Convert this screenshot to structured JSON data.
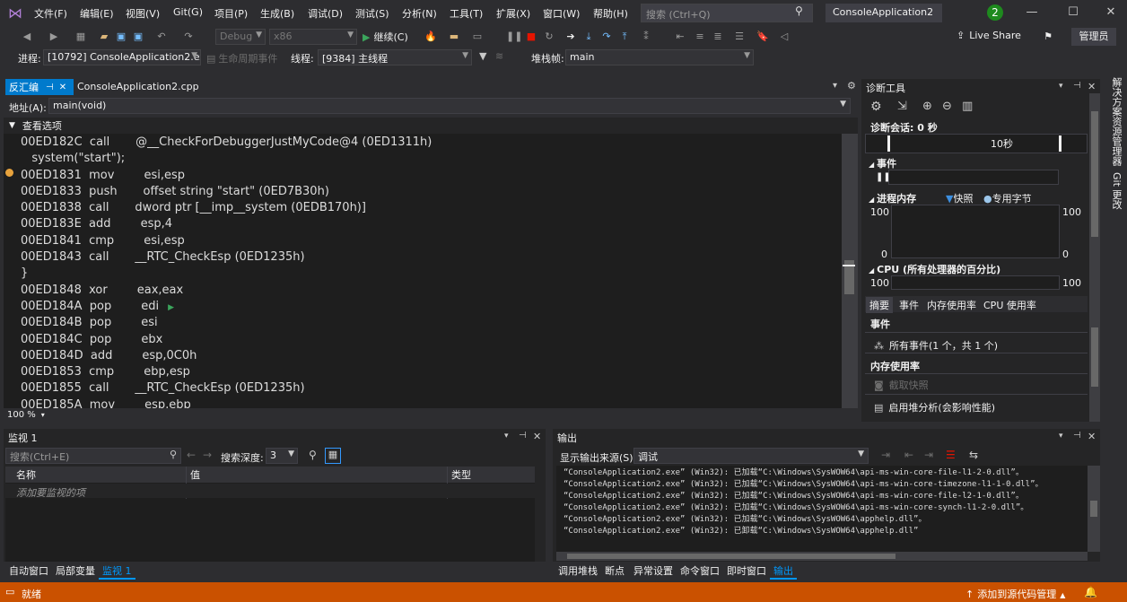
{
  "menubar": {
    "items": [
      "文件(F)",
      "编辑(E)",
      "视图(V)",
      "Git(G)",
      "项目(P)",
      "生成(B)",
      "调试(D)",
      "测试(S)",
      "分析(N)",
      "工具(T)",
      "扩展(X)",
      "窗口(W)",
      "帮助(H)"
    ],
    "search_placeholder": "搜索 (Ctrl+Q)",
    "project_name": "ConsoleApplication2",
    "notification_count": "2"
  },
  "toolbar": {
    "config": "Debug",
    "platform": "x86",
    "continue_label": "继续(C)",
    "live_share": "Live Share",
    "admin": "管理员"
  },
  "debugbar": {
    "process_label": "进程:",
    "process_value": "[10792] ConsoleApplication2.ex",
    "lifecycle": "生命周期事件",
    "thread_label": "线程:",
    "thread_value": "[9384] 主线程",
    "stackframe_label": "堆栈帧:",
    "stackframe_value": "main"
  },
  "editor": {
    "tab_disasm": "反汇编",
    "tab_cpp": "ConsoleApplication2.cpp",
    "address_label": "地址(A):",
    "address_value": "main(void)",
    "view_options": "查看选项",
    "zoom": "100 %",
    "lines": [
      "00ED182C  call       @__CheckForDebuggerJustMyCode@4 (0ED1311h)",
      "   system(\"start\");",
      "00ED1831  mov        esi,esp",
      "00ED1833  push       offset string \"start\" (0ED7B30h)",
      "00ED1838  call       dword ptr [__imp__system (0EDB170h)]",
      "00ED183E  add        esp,4",
      "00ED1841  cmp        esi,esp",
      "00ED1843  call       __RTC_CheckEsp (0ED1235h)",
      "}",
      "00ED1848  xor        eax,eax",
      "00ED184A  pop        edi",
      "00ED184B  pop        esi",
      "00ED184C  pop        ebx",
      "00ED184D  add        esp,0C0h",
      "00ED1853  cmp        ebp,esp",
      "00ED1855  call       __RTC_CheckEsp (0ED1235h)",
      "00ED185A  mov        esp,ebp"
    ]
  },
  "diagnostics": {
    "title": "诊断工具",
    "session": "诊断会话: 0 秒",
    "timeline_label": "10秒",
    "events_section": "事件",
    "memory_section": "进程内存",
    "snapshot_legend": "快照",
    "private_bytes_legend": "专用字节",
    "mem_top_left": "100",
    "mem_top_right": "100",
    "mem_bottom_left": "0",
    "mem_bottom_right": "0",
    "cpu_section": "CPU (所有处理器的百分比)",
    "cpu_left": "100",
    "cpu_right": "100",
    "tabs": [
      "摘要",
      "事件",
      "内存使用率",
      "CPU 使用率"
    ],
    "events_heading": "事件",
    "all_events": "所有事件(1 个，共 1 个)",
    "memory_heading": "内存使用率",
    "take_snapshot": "截取快照",
    "heap_profiling": "启用堆分析(会影响性能)"
  },
  "sidebar": {
    "solution_explorer": "解决方案资源管理器",
    "git_changes": "Git 更改"
  },
  "watch": {
    "title": "监视 1",
    "search_placeholder": "搜索(Ctrl+E)",
    "depth_label": "搜索深度:",
    "depth_value": "3",
    "col_name": "名称",
    "col_value": "值",
    "col_type": "类型",
    "add_item": "添加要监视的项"
  },
  "output": {
    "title": "输出",
    "source_label": "显示输出来源(S):",
    "source_value": "调试",
    "lines": [
      "“ConsoleApplication2.exe” (Win32): 已加载“C:\\Windows\\SysWOW64\\api-ms-win-core-file-l1-2-0.dll”。",
      "“ConsoleApplication2.exe” (Win32): 已加载“C:\\Windows\\SysWOW64\\api-ms-win-core-timezone-l1-1-0.dll”。",
      "“ConsoleApplication2.exe” (Win32): 已加载“C:\\Windows\\SysWOW64\\api-ms-win-core-file-l2-1-0.dll”。",
      "“ConsoleApplication2.exe” (Win32): 已加载“C:\\Windows\\SysWOW64\\api-ms-win-core-synch-l1-2-0.dll”。",
      "“ConsoleApplication2.exe” (Win32): 已加载“C:\\Windows\\SysWOW64\\apphelp.dll”。",
      "“ConsoleApplication2.exe” (Win32): 已卸载“C:\\Windows\\SysWOW64\\apphelp.dll”"
    ]
  },
  "bottom_tabs_left": [
    "自动窗口",
    "局部变量",
    "监视 1"
  ],
  "bottom_tabs_right": [
    "调用堆栈",
    "断点",
    "异常设置",
    "命令窗口",
    "即时窗口",
    "输出"
  ],
  "statusbar": {
    "ready": "就绪",
    "source_control": "添加到源代码管理"
  }
}
